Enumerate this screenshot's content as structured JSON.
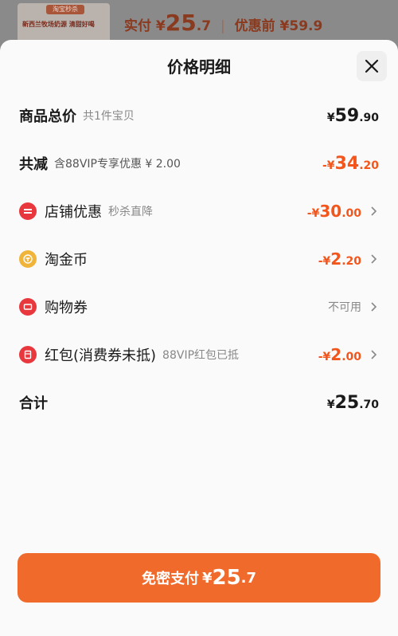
{
  "background": {
    "thumb_tag": "淘宝秒杀",
    "thumb_text": "新西兰牧场奶源 清甜好喝",
    "paid_label": "实付",
    "paid_currency": "¥",
    "paid_int": "25",
    "paid_dec": ".7",
    "separator": "|",
    "before_label": "优惠前",
    "before_value": "¥59.9"
  },
  "sheet": {
    "title": "价格明细",
    "rows": [
      {
        "label": "商品总价",
        "sub": "共1件宝贝",
        "currency": "¥",
        "int": "59",
        "dec": ".90"
      },
      {
        "label": "共减",
        "sub": "含88VIP专享优惠 ¥ 2.00",
        "currency": "-¥",
        "int": "34",
        "dec": ".20"
      },
      {
        "label": "店铺优惠",
        "sub": "秒杀直降",
        "currency": "-¥",
        "int": "30",
        "dec": ".00",
        "icon": "shop-discount-icon"
      },
      {
        "label": "淘金币",
        "sub": "",
        "currency": "-¥",
        "int": "2",
        "dec": ".20",
        "icon": "gold-coin-icon"
      },
      {
        "label": "购物券",
        "sub": "",
        "status": "不可用",
        "icon": "coupon-icon"
      },
      {
        "label": "红包(消费券未抵)",
        "sub": "88VIP红包已抵",
        "currency": "-¥",
        "int": "2",
        "dec": ".00",
        "icon": "red-packet-icon"
      },
      {
        "label": "合计",
        "sub": "",
        "currency": "¥",
        "int": "25",
        "dec": ".70"
      }
    ]
  },
  "pay_button": {
    "label": "免密支付",
    "currency": "¥",
    "int": "25",
    "dec": ".7"
  },
  "colors": {
    "accent": "#f06a2b",
    "discount": "#f2561d",
    "icon_red": "#e8383d",
    "icon_gold": "#f0b43a"
  }
}
